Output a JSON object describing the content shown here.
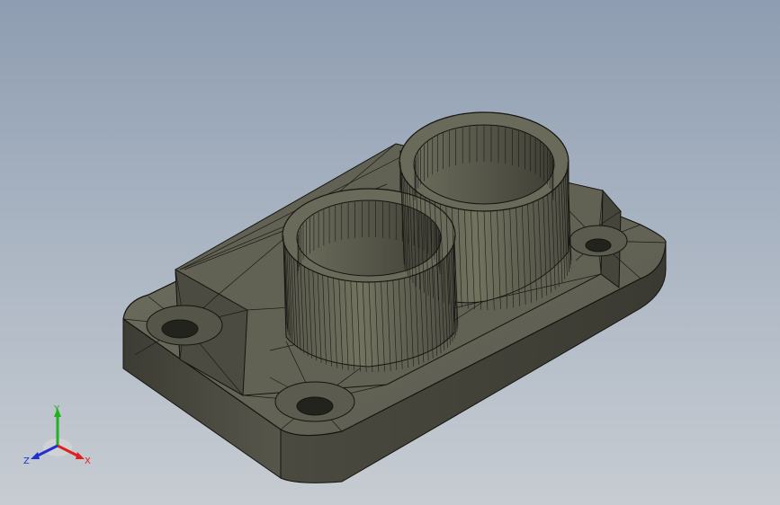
{
  "viewport": {
    "background_top": "#8e9db1",
    "background_bottom": "#c7ccd2"
  },
  "model": {
    "shading_color": "#5e5e52",
    "edge_color": "#151510",
    "feature_icon": "mesh-part-icon"
  },
  "triad": {
    "x_label": "X",
    "y_label": "Y",
    "z_label": "Z",
    "x_color": "#e02020",
    "y_color": "#20b020",
    "z_color": "#2030d0"
  }
}
